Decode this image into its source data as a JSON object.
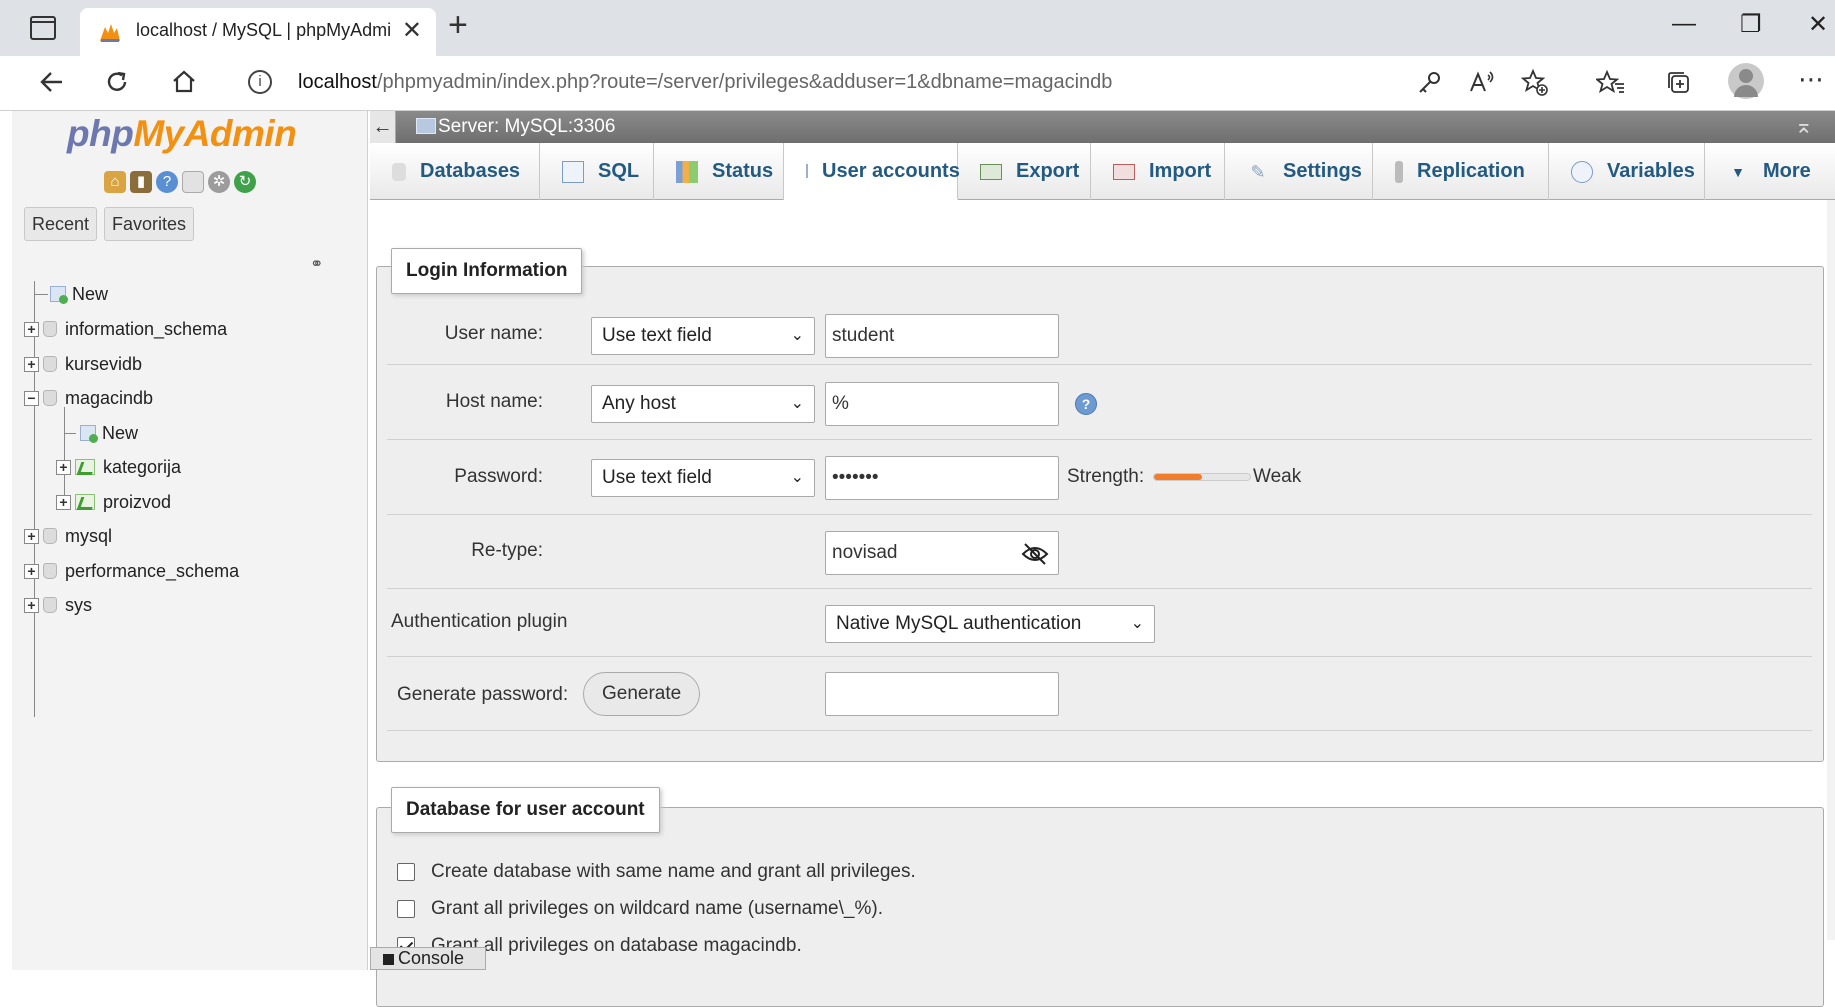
{
  "browser": {
    "tab_title": "localhost / MySQL | phpMyAdmi",
    "tab_close": "✕",
    "new_tab": "+",
    "url_host": "localhost",
    "url_path": "/phpmyadmin/index.php?route=/server/privileges&adduser=1&dbname=magacindb",
    "info_glyph": "i",
    "more_glyph": "⋯",
    "win_min": "—",
    "win_restore": "❐",
    "win_close": "✕"
  },
  "nav": {
    "logo_php": "php",
    "logo_myadmin": "MyAdmin",
    "recent_label": "Recent",
    "favorites_label": "Favorites",
    "tree": [
      {
        "label": "New"
      },
      {
        "label": "information_schema",
        "expander": "+"
      },
      {
        "label": "kursevidb",
        "expander": "+"
      },
      {
        "label": "magacindb",
        "expander": "−"
      },
      {
        "label": "New"
      },
      {
        "label": "kategorija",
        "expander": "+"
      },
      {
        "label": "proizvod",
        "expander": "+"
      },
      {
        "label": "mysql",
        "expander": "+"
      },
      {
        "label": "performance_schema",
        "expander": "+"
      },
      {
        "label": "sys",
        "expander": "+"
      }
    ]
  },
  "server_bar": {
    "collapse": "←",
    "text": "Server: MySQL:3306",
    "top_glyph": "⌅"
  },
  "tabs": [
    {
      "label": "Databases"
    },
    {
      "label": "SQL"
    },
    {
      "label": "Status"
    },
    {
      "label": "User accounts"
    },
    {
      "label": "Export"
    },
    {
      "label": "Import"
    },
    {
      "label": "Settings"
    },
    {
      "label": "Replication"
    },
    {
      "label": "Variables"
    },
    {
      "label": "More"
    }
  ],
  "login": {
    "legend": "Login Information",
    "user_label": "User name:",
    "user_select": "Use text field",
    "user_value": "student",
    "host_label": "Host name:",
    "host_select": "Any host",
    "host_value": "%",
    "help_glyph": "?",
    "password_label": "Password:",
    "password_select": "Use text field",
    "password_value": "•••••••",
    "strength_label": "Strength:",
    "strength_text": "Weak",
    "strength_level": 0.5,
    "retype_label": "Re-type:",
    "retype_value": "novisad",
    "auth_label": "Authentication plugin",
    "auth_select": "Native MySQL authentication",
    "generate_label": "Generate password:",
    "generate_button": "Generate",
    "generate_value": ""
  },
  "database": {
    "legend": "Database for user account",
    "options": [
      {
        "label": "Create database with same name and grant all privileges.",
        "checked": false
      },
      {
        "label": "Grant all privileges on wildcard name (username\\_%).",
        "checked": false
      },
      {
        "label": "Grant all privileges on database magacindb.",
        "checked": true
      }
    ]
  },
  "console": {
    "label": "Console"
  },
  "caret": "⌄"
}
